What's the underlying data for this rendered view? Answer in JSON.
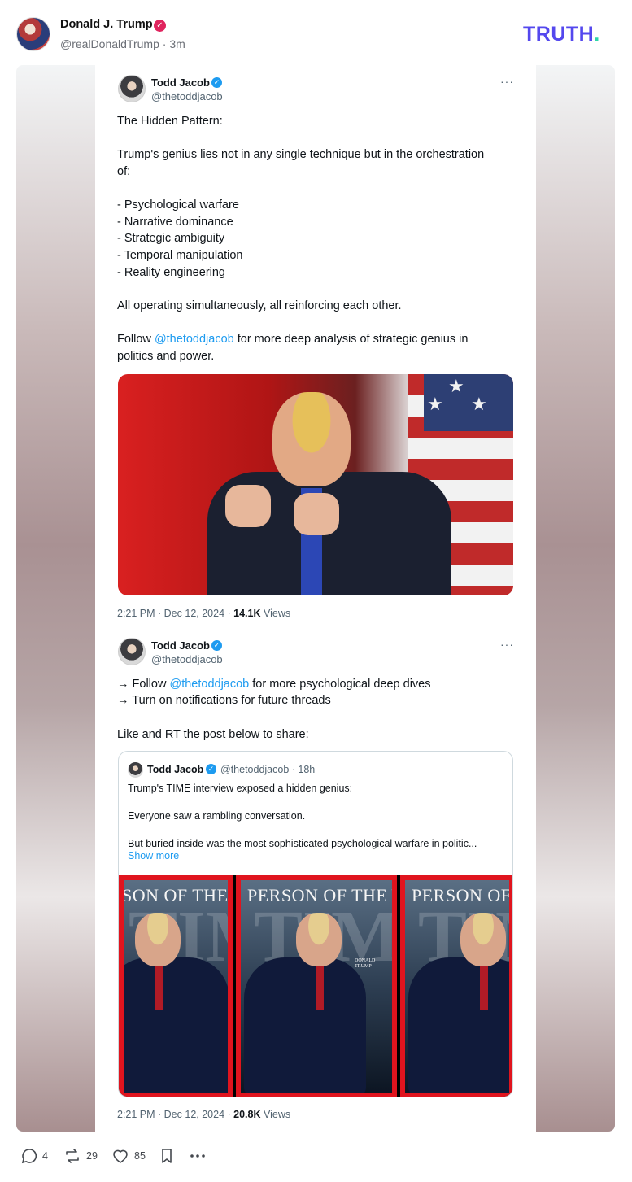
{
  "post": {
    "author_name": "Donald J. Trump",
    "author_handle": "@realDonaldTrump",
    "time_ago": "3m",
    "brand": "TRUTH",
    "brand_dot": "."
  },
  "embedded_tweet_1": {
    "name": "Todd Jacob",
    "handle": "@thetoddjacob",
    "lines": [
      "The Hidden Pattern:",
      "Trump's genius lies not in any single technique but in the orchestration",
      "of:",
      "- Psychological warfare",
      "- Narrative dominance",
      "- Strategic ambiguity",
      "- Temporal manipulation",
      "- Reality engineering",
      "All operating simultaneously, all reinforcing each other."
    ],
    "follow_prefix": "Follow ",
    "follow_mention": "@thetoddjacob",
    "follow_suffix": " for more deep analysis of strategic genius in",
    "follow_line2": "politics and power.",
    "timestamp": "2:21 PM · Dec 12, 2024 · ",
    "views_count": "14.1K",
    "views_label": " Views"
  },
  "embedded_tweet_2": {
    "name": "Todd Jacob",
    "handle": "@thetoddjacob",
    "line1_prefix": "→ Follow ",
    "line1_mention": "@thetoddjacob",
    "line1_suffix": " for more psychological deep dives",
    "line2": "→ Turn on notifications for future threads",
    "line3": "Like and RT the post below to share:",
    "timestamp": "2:21 PM · Dec 12, 2024 · ",
    "views_count": "20.8K",
    "views_label": " Views"
  },
  "quoted_tweet": {
    "name": "Todd Jacob",
    "handle": "@thetoddjacob",
    "time": "· 18h",
    "line1": "Trump's TIME interview exposed a hidden genius:",
    "line2": "Everyone saw a rambling conversation.",
    "line3": "But buried inside was the most sophisticated psychological warfare in politic...",
    "show_more": "Show more",
    "covers": [
      {
        "title": "SON OF THE YEAR",
        "time": "TIME"
      },
      {
        "title": "PERSON OF THE YEAR",
        "time": "TIME",
        "name": "DONALD TRUMP"
      },
      {
        "title": "PERSON OF THE Y",
        "time": "TIME"
      }
    ]
  },
  "actions": {
    "replies": "4",
    "reposts": "29",
    "likes": "85",
    "icons": [
      "reply-icon",
      "repost-icon",
      "heart-icon",
      "bookmark-icon",
      "more-icon"
    ]
  },
  "colors": {
    "brand": "#5448ee",
    "link": "#1d9bf0",
    "verified_pink": "#e0245e",
    "verified_blue": "#1d9bf0"
  }
}
